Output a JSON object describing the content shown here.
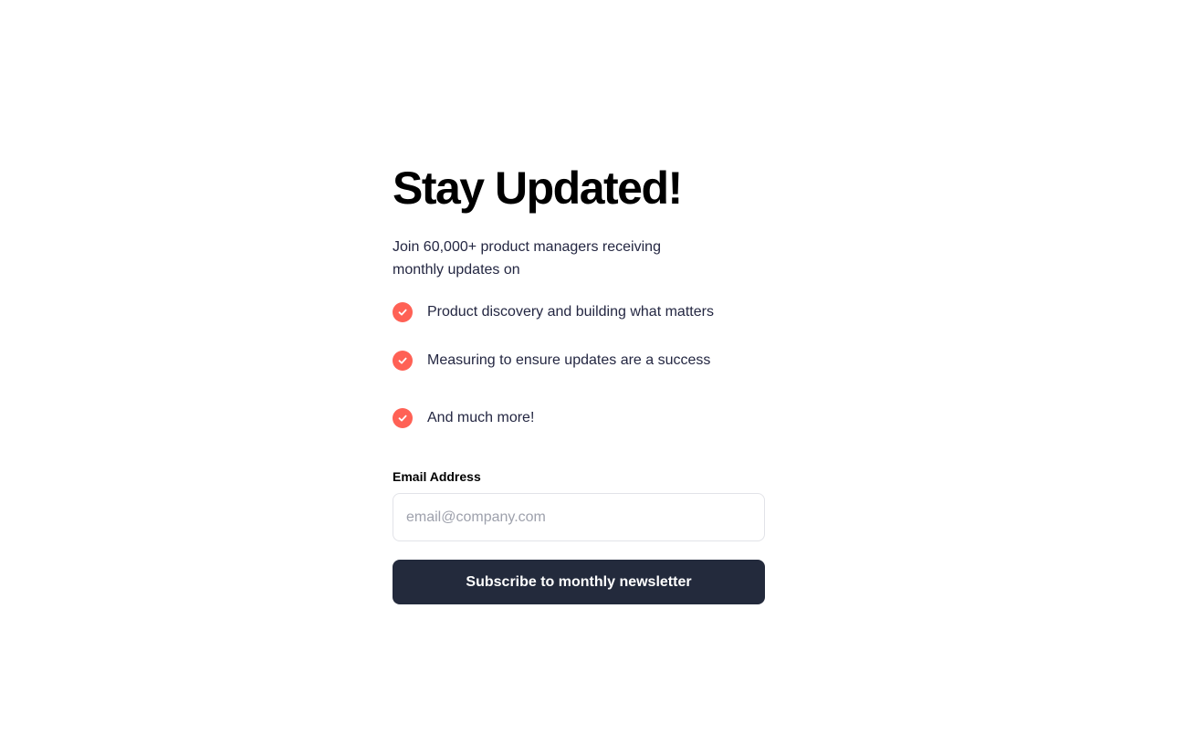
{
  "newsletter": {
    "title": "Stay Updated!",
    "subtitle": "Join 60,000+ product managers receiving monthly updates on",
    "features": [
      {
        "icon": "check-circle-icon",
        "text": "Product discovery and building what matters"
      },
      {
        "icon": "check-circle-icon",
        "text": "Measuring to ensure updates are a success"
      },
      {
        "icon": "check-circle-icon",
        "text": "And much more!"
      }
    ],
    "email": {
      "label": "Email Address",
      "value": "",
      "placeholder": "email@company.com"
    },
    "submit_label": "Subscribe to monthly newsletter"
  },
  "colors": {
    "accent": "#ff6155",
    "button_bg": "#232a3c",
    "text": "#242742",
    "input_border": "#e2e3e8",
    "placeholder": "#9ea1ac"
  }
}
